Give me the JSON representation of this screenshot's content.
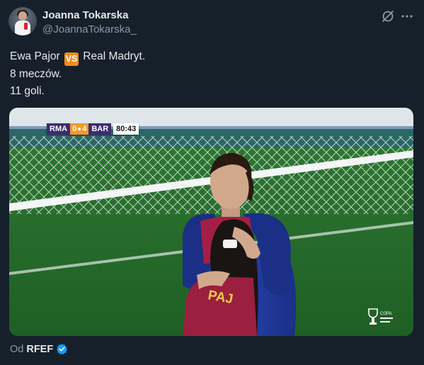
{
  "author": {
    "name": "Joanna Tokarska",
    "handle": "@JoannaTokarska_",
    "avatar_icon": "avatar-photo"
  },
  "header_icons": [
    "grok-icon",
    "more-icon"
  ],
  "tweet": {
    "line1_before": "Ewa Pajor",
    "emoji_text": "VS",
    "line1_after": "Real Madryt.",
    "line2": "8 meczów.",
    "line3": "11 goli."
  },
  "media": {
    "scoreboard": {
      "home": "RMA",
      "home_score": "0",
      "away_score": "4",
      "away": "BAR",
      "clock": "80:43"
    },
    "logo_text": "COPA"
  },
  "attribution": {
    "prefix": "Od",
    "source": "RFEF",
    "verified_icon": "verified-badge-icon"
  },
  "colors": {
    "background": "#15202b",
    "text_primary": "#e7e9ea",
    "text_secondary": "#8b98a5",
    "verified_blue": "#1d9bf0",
    "vs_orange": "#f28c1a"
  }
}
